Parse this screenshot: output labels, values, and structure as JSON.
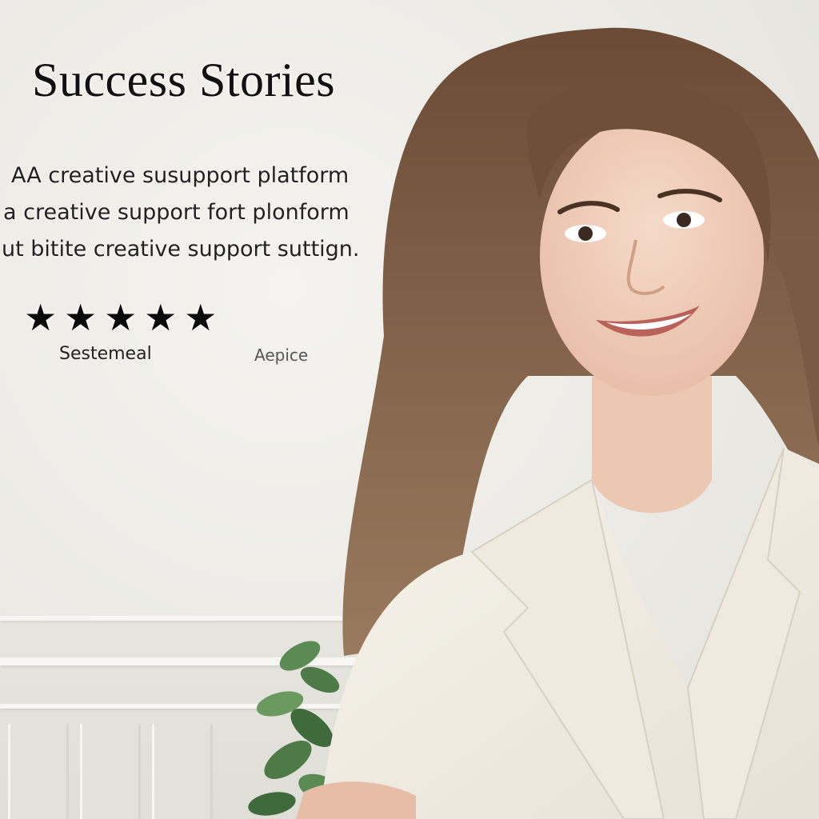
{
  "page": {
    "title": "Success Stories",
    "body_lines": [
      "AA creative susupport platform",
      "a creative support fort plonform",
      "ut bitite creative support suttign."
    ],
    "rating": {
      "stars_filled": 5,
      "stars_total": 5,
      "star_glyph": "★"
    },
    "caption_left": "Sestemeal",
    "caption_right": "Aepice"
  },
  "colors": {
    "wall": "#ecebe6",
    "text": "#111111",
    "blazer": "#f3f0e6",
    "hair": "#7a5a42",
    "plant": "#4d7a46"
  },
  "icons": {
    "star": "star-icon"
  }
}
